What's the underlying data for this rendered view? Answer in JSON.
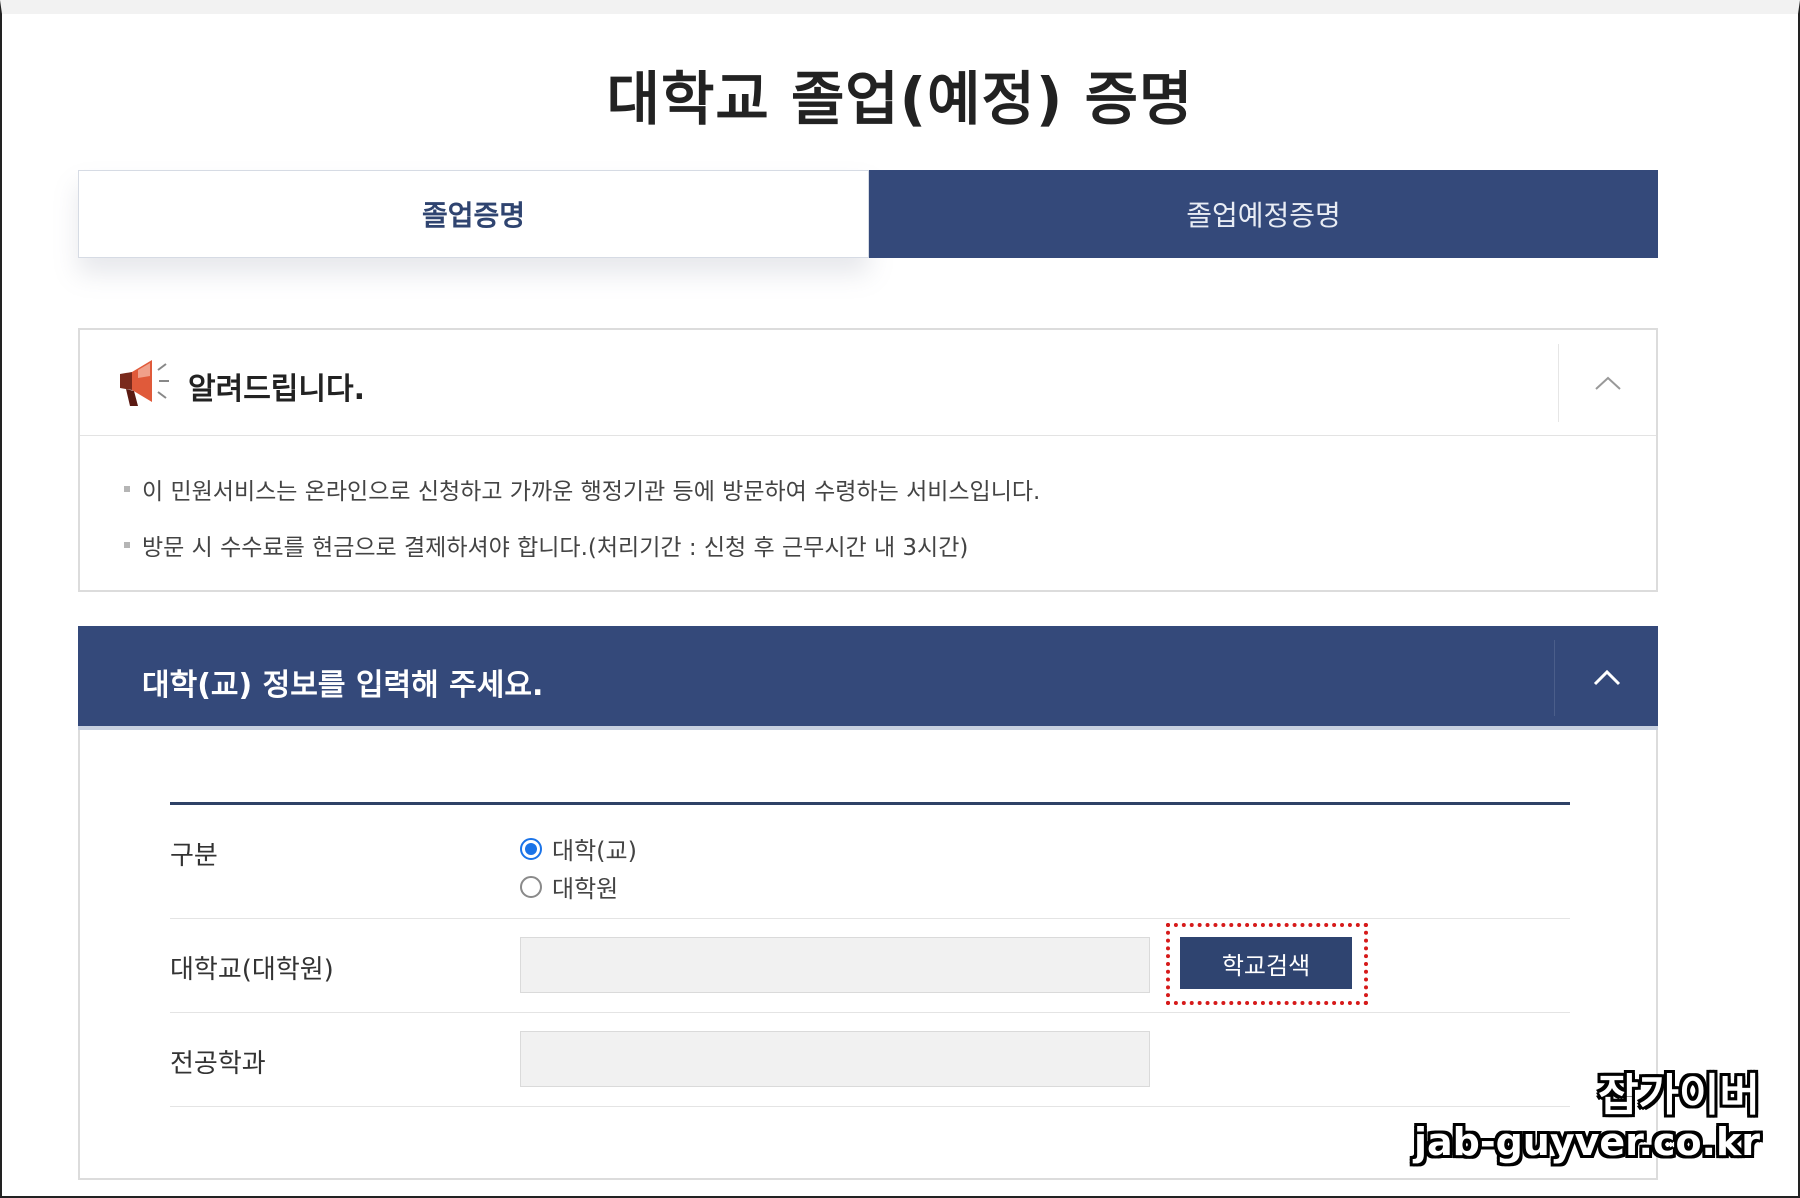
{
  "page": {
    "title": "대학교 졸업(예정) 증명"
  },
  "tabs": [
    {
      "label": "졸업증명",
      "active": true
    },
    {
      "label": "졸업예정증명",
      "active": false
    }
  ],
  "notice": {
    "title": "알려드립니다.",
    "icon": "megaphone-icon",
    "lines": [
      "이 민원서비스는 온라인으로 신청하고 가까운 행정기관 등에 방문하여 수령하는 서비스입니다.",
      "방문 시 수수료를 현금으로 결제하셔야 합니다.(처리기간 : 신청 후 근무시간 내 3시간)"
    ]
  },
  "info": {
    "title": "대학(교) 정보를 입력해 주세요.",
    "rows": {
      "type_label": "구분",
      "type_options": [
        "대학(교)",
        "대학원"
      ],
      "type_selected": "대학(교)",
      "school_label": "대학교(대학원)",
      "school_value": "",
      "search_button": "학교검색",
      "major_label": "전공학과",
      "major_value": ""
    }
  },
  "watermark": {
    "line1": "잡가이버",
    "line2": "jab-guyver.co.kr"
  },
  "colors": {
    "navy": "#34497a",
    "highlight": "#d61a1a",
    "radio": "#1a73e8"
  }
}
